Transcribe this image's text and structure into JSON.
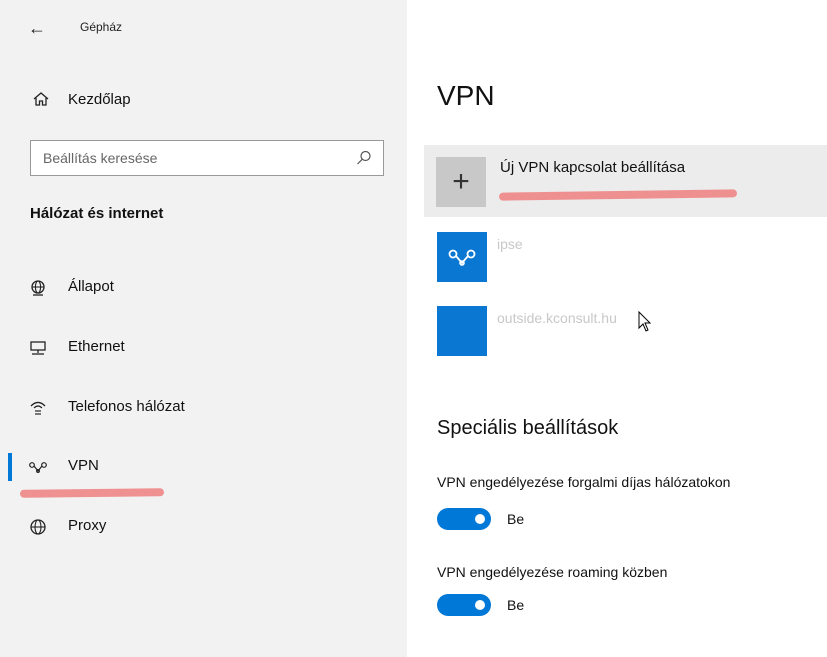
{
  "window": {
    "title": "Gépház"
  },
  "sidebar": {
    "home_label": "Kezdőlap",
    "search": {
      "placeholder": "Beállítás keresése"
    },
    "section_title": "Hálózat és internet",
    "items": [
      {
        "label": "Állapot",
        "icon": "globe-status-icon"
      },
      {
        "label": "Ethernet",
        "icon": "ethernet-icon"
      },
      {
        "label": "Telefonos hálózat",
        "icon": "dialup-icon"
      },
      {
        "label": "VPN",
        "icon": "vpn-icon",
        "selected": true
      },
      {
        "label": "Proxy",
        "icon": "globe-icon"
      }
    ]
  },
  "main": {
    "title": "VPN",
    "add_vpn_label": "Új VPN kapcsolat beállítása",
    "connections": [
      {
        "name": "ipse",
        "icon": "vpn-icon"
      },
      {
        "name": "outside.kconsult.hu",
        "icon": "blank-tile"
      }
    ],
    "advanced": {
      "title": "Speciális beállítások",
      "options": [
        {
          "label": "VPN engedélyezése forgalmi díjas hálózatokon",
          "state": "Be",
          "on": true
        },
        {
          "label": "VPN engedélyezése roaming közben",
          "state": "Be",
          "on": true
        }
      ]
    }
  },
  "colors": {
    "accent": "#0078d7",
    "tile": "#0a78d2",
    "highlight": "#f08080",
    "sidebar_bg": "#f2f2f2"
  }
}
